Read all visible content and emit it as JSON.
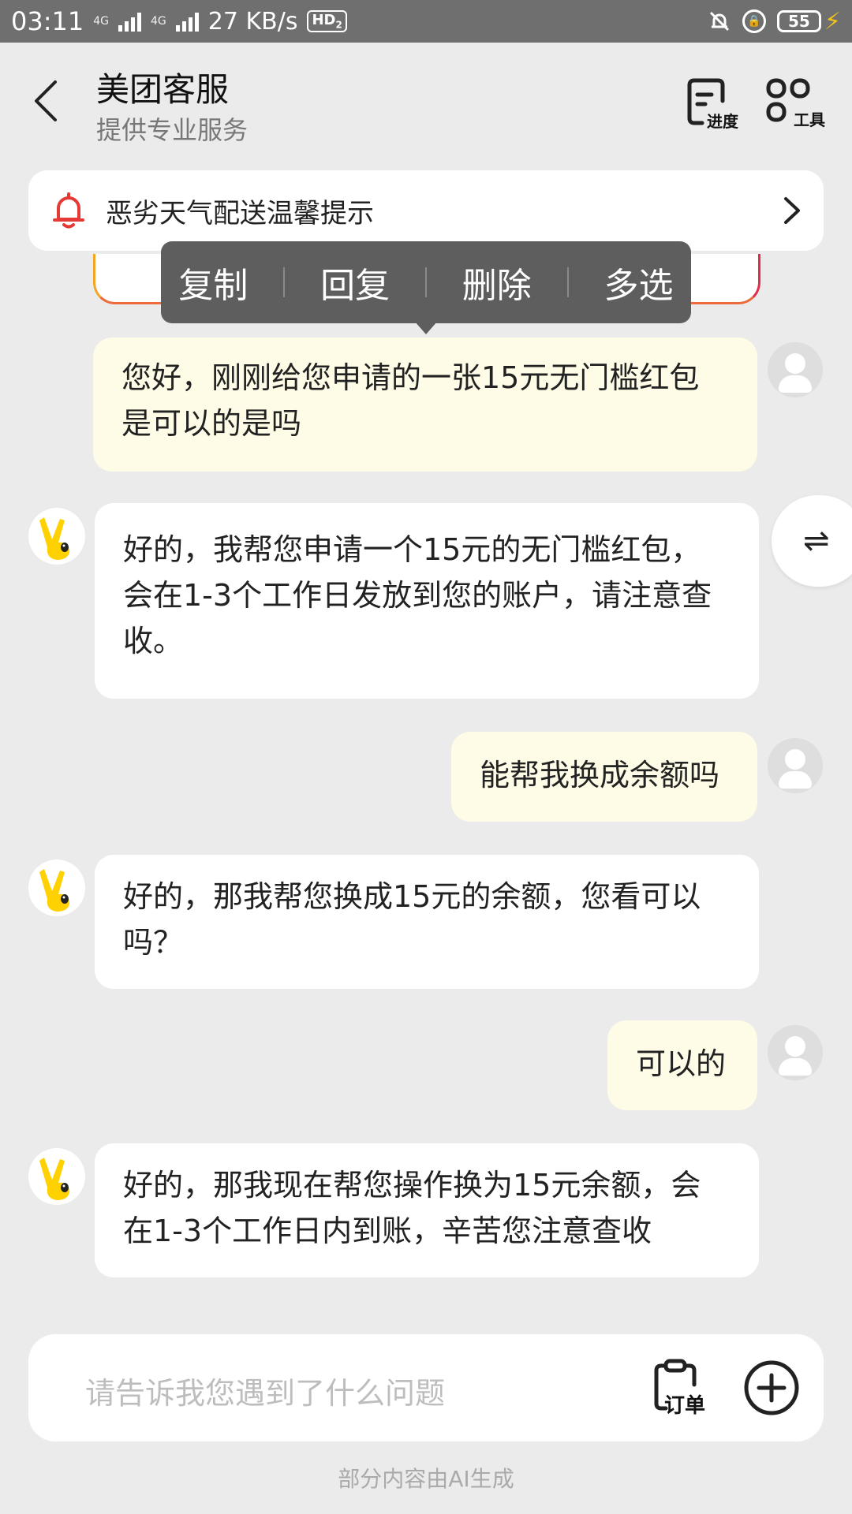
{
  "status_bar": {
    "time": "03:11",
    "net_label_1": "4G",
    "net_label_2": "4G",
    "speed": "27 KB/s",
    "hd": "HD",
    "hd_sub": "2",
    "battery": "55"
  },
  "header": {
    "title": "美团客服",
    "subtitle": "提供专业服务",
    "progress_label": "进度",
    "tools_label": "工具"
  },
  "notice": {
    "text": "恶劣天气配送温馨提示"
  },
  "context_menu": {
    "copy": "复制",
    "reply": "回复",
    "delete": "删除",
    "multi_select": "多选"
  },
  "messages": [
    {
      "from": "user",
      "text": "您好，刚刚给您申请的一张15元无门槛红包是可以的是吗"
    },
    {
      "from": "agent",
      "text": "好的，我帮您申请一个15元的无门槛红包，会在1-3个工作日发放到您的账户，请注意查收。"
    },
    {
      "from": "user",
      "text": "能帮我换成余额吗"
    },
    {
      "from": "agent",
      "text": "好的，那我帮您换成15元的余额，您看可以吗？"
    },
    {
      "from": "user",
      "text": "可以的"
    },
    {
      "from": "agent",
      "text": "好的，那我现在帮您操作换为15元余额，会在1-3个工作日内到账，辛苦您注意查收"
    }
  ],
  "switch_icon": "⇌",
  "input": {
    "placeholder": "请告诉我您遇到了什么问题",
    "order_label": "订单"
  },
  "footer": {
    "note": "部分内容由AI生成"
  },
  "colors": {
    "accent_yellow": "#ffd100",
    "user_bubble": "#fefce6",
    "bell_red": "#e53935"
  }
}
